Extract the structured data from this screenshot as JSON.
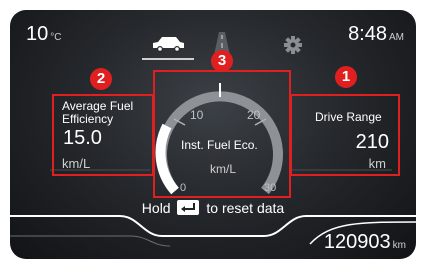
{
  "status_bar": {
    "outside_temp": "10",
    "temp_unit": "°C",
    "time": "8:48",
    "ampm": "AM"
  },
  "tabs": [
    {
      "icon": "car-icon",
      "active": true
    },
    {
      "icon": "road-icon",
      "active": false
    },
    {
      "icon": "gear-icon",
      "active": false
    }
  ],
  "drive_range": {
    "badge": "1",
    "label": "Drive Range",
    "value": "210",
    "unit": "km"
  },
  "avg_fuel": {
    "badge": "2",
    "label_line1": "Average Fuel",
    "label_line2": "Efficiency",
    "value": "15.0",
    "unit": "km/L"
  },
  "inst_fuel": {
    "badge": "3",
    "label": "Inst. Fuel Eco.",
    "unit": "km/L",
    "ticks": [
      "0",
      "10",
      "20",
      "30"
    ]
  },
  "hint": {
    "before": "Hold",
    "after": "to reset data"
  },
  "odometer": {
    "value": "120903",
    "unit": "km"
  },
  "colors": {
    "highlight": "#e02020",
    "background": "#25282c",
    "text": "#ffffff"
  }
}
